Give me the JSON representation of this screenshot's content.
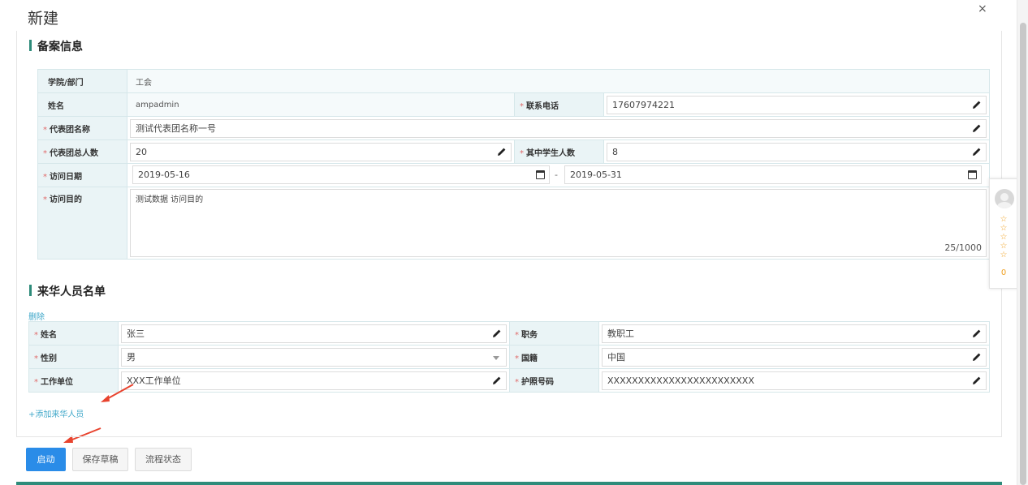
{
  "dialog": {
    "title": "新建",
    "close": "×"
  },
  "filing": {
    "title": "备案信息",
    "dept_label": "学院/部门",
    "dept_value": "工会",
    "name_label": "姓名",
    "name_value": "ampadmin",
    "phone_label": "联系电话",
    "phone_value": "17607974221",
    "delegation_label": "代表团名称",
    "delegation_value": "测试代表团名称一号",
    "total_label": "代表团总人数",
    "total_value": "20",
    "students_label": "其中学生人数",
    "students_value": "8",
    "date_label": "访问日期",
    "date_start": "2019-05-16",
    "date_sep": "-",
    "date_end": "2019-05-31",
    "purpose_label": "访问目的",
    "purpose_value": "测试数据 访问目的",
    "purpose_counter": "25/1000"
  },
  "visitors": {
    "title": "来华人员名单",
    "delete_link": "删除",
    "name_label": "姓名",
    "name_value": "张三",
    "position_label": "职务",
    "position_value": "教职工",
    "gender_label": "性别",
    "gender_value": "男",
    "nationality_label": "国籍",
    "nationality_value": "中国",
    "employer_label": "工作单位",
    "employer_value": "XXX工作单位",
    "passport_label": "护照号码",
    "passport_value": "XXXXXXXXXXXXXXXXXXXXXXXX",
    "add_link": "+添加来华人员"
  },
  "required_mark": "*",
  "footer": {
    "start": "启动",
    "save_draft": "保存草稿",
    "flow_status": "流程状态"
  },
  "side_widget": {
    "stars": [
      "☆",
      "☆",
      "☆",
      "☆",
      "☆"
    ],
    "count": "0"
  },
  "colors": {
    "primary": "#2a8ce8",
    "accent": "#2e8b7a",
    "link": "#3fa7c9",
    "required": "#e06a6a",
    "annotation": "#e8432e"
  },
  "icons": [
    "edit-icon",
    "calendar-icon",
    "dropdown-icon",
    "close-icon",
    "avatar-icon",
    "star-icon"
  ]
}
